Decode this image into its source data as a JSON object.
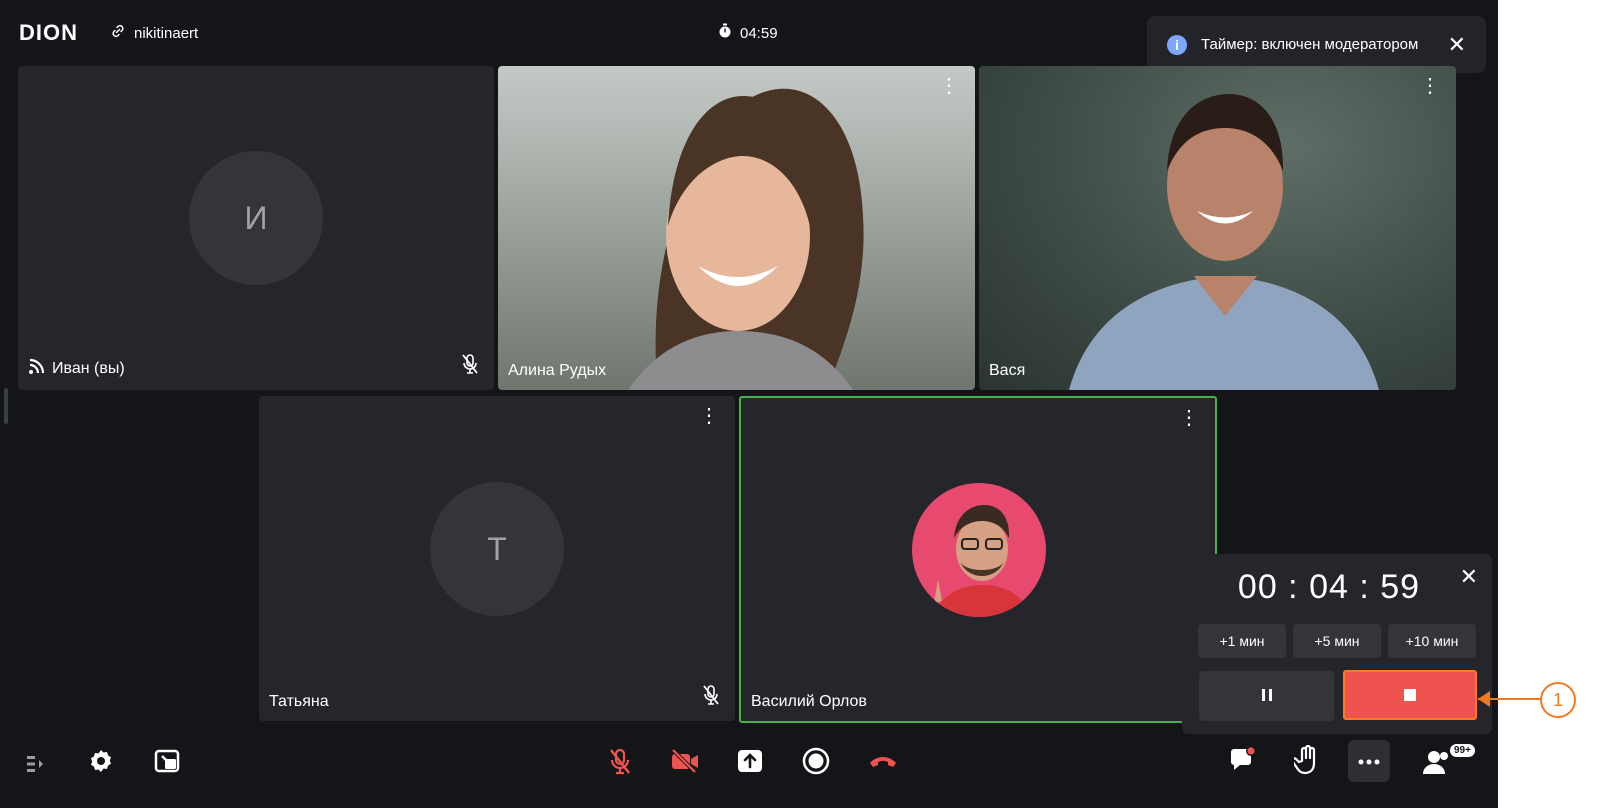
{
  "header": {
    "logo": "DION",
    "room_name": "nikitinaert",
    "timer": "04:59"
  },
  "toast": {
    "message": "Таймер: включен модератором"
  },
  "tiles": [
    {
      "name": "Иван (вы)",
      "initial": "И"
    },
    {
      "name": "Алина Рудых"
    },
    {
      "name": "Вася"
    },
    {
      "name": "Татьяна",
      "initial": "Т"
    },
    {
      "name": "Василий Орлов"
    }
  ],
  "timer_panel": {
    "time": "00 : 04 : 59",
    "add_buttons": [
      "+1 мин",
      "+5 мин",
      "+10 мин"
    ]
  },
  "bottom_bar": {
    "participants_badge": "99+"
  },
  "annotation": {
    "label": "1"
  },
  "colors": {
    "background": "#141519",
    "tile": "#25262c",
    "active_border": "#4caf50",
    "danger": "#ef5350",
    "annotation": "#f07a20"
  }
}
